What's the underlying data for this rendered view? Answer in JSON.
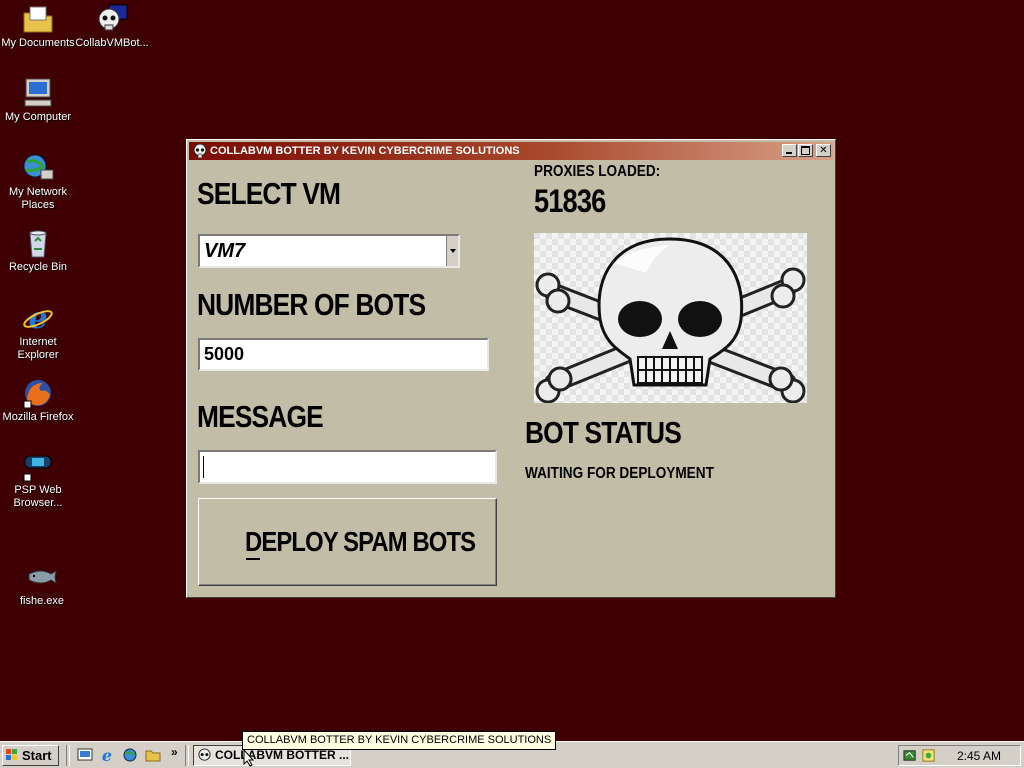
{
  "desktop": {
    "icons": [
      {
        "label": "My Documents",
        "icon": "folder-documents-icon"
      },
      {
        "label": "CollabVMBot...",
        "icon": "skull-app-icon"
      },
      {
        "label": "My Computer",
        "icon": "computer-icon"
      },
      {
        "label": "My Network Places",
        "icon": "network-icon"
      },
      {
        "label": "Recycle Bin",
        "icon": "recycle-bin-icon"
      },
      {
        "label": "Internet Explorer",
        "icon": "ie-icon"
      },
      {
        "label": "Mozilla Firefox",
        "icon": "firefox-icon"
      },
      {
        "label": "PSP Web Browser...",
        "icon": "psp-icon"
      },
      {
        "label": "fishe.exe",
        "icon": "fish-icon"
      }
    ]
  },
  "window": {
    "title": "COLLABVM BOTTER BY KEVIN CYBERCRIME SOLUTIONS",
    "select_vm_label": "SELECT VM",
    "vm_selected": "VM7",
    "bots_label": "NUMBER OF BOTS",
    "bots_value": "5000",
    "message_label": "MESSAGE",
    "message_value": "",
    "deploy_button": "DEPLOY SPAM BOTS",
    "proxies_label": "PROXIES LOADED:",
    "proxies_count": "51836",
    "status_label": "BOT STATUS",
    "status_value": "WAITING FOR DEPLOYMENT"
  },
  "taskbar": {
    "start_label": "Start",
    "task_item_label": "COLLABVM BOTTER ...",
    "clock": "2:45 AM",
    "tooltip": "COLLABVM BOTTER BY KEVIN CYBERCRIME SOLUTIONS"
  },
  "colors": {
    "desktop": "#3f0004",
    "window_face": "#c1bda6",
    "titlebar": "#7b0a02"
  }
}
